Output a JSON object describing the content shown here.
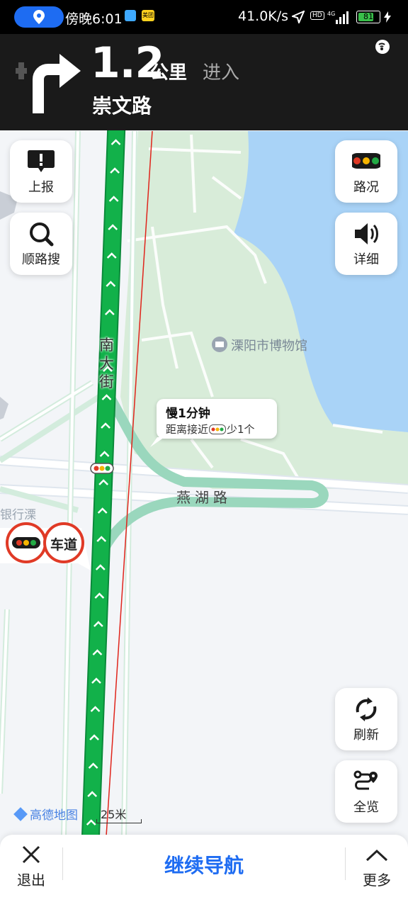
{
  "status_bar": {
    "time": "傍晚6:01",
    "app_badge": "美团",
    "network_speed": "41.0K/s",
    "hd_label": "HD",
    "battery": "81"
  },
  "navigation": {
    "distance": "1.2",
    "unit": "公里",
    "action": "进入",
    "road": "崇文路"
  },
  "buttons": {
    "report": "上报",
    "search_along": "顺路搜",
    "traffic": "路况",
    "detail": "详细",
    "refresh": "刷新",
    "overview": "全览"
  },
  "map": {
    "street_vertical": "南大街",
    "street_horizontal": "燕湖路",
    "poi": "溧阳市博物馆",
    "bank_label": "银行溧",
    "lane_label": "车道"
  },
  "callout": {
    "title": "慢1分钟",
    "text_before": "距离接近",
    "text_after": "少1个"
  },
  "footer": {
    "brand": "高德地图",
    "scale": "25米"
  },
  "bottom_bar": {
    "exit": "退出",
    "continue": "继续导航",
    "more": "更多"
  },
  "colors": {
    "route_green": "#12b14a",
    "water_blue": "#a9d3f7",
    "park_green": "#d8ecd9",
    "accent_blue": "#1e6cf2",
    "alert_red": "#e03a26"
  }
}
